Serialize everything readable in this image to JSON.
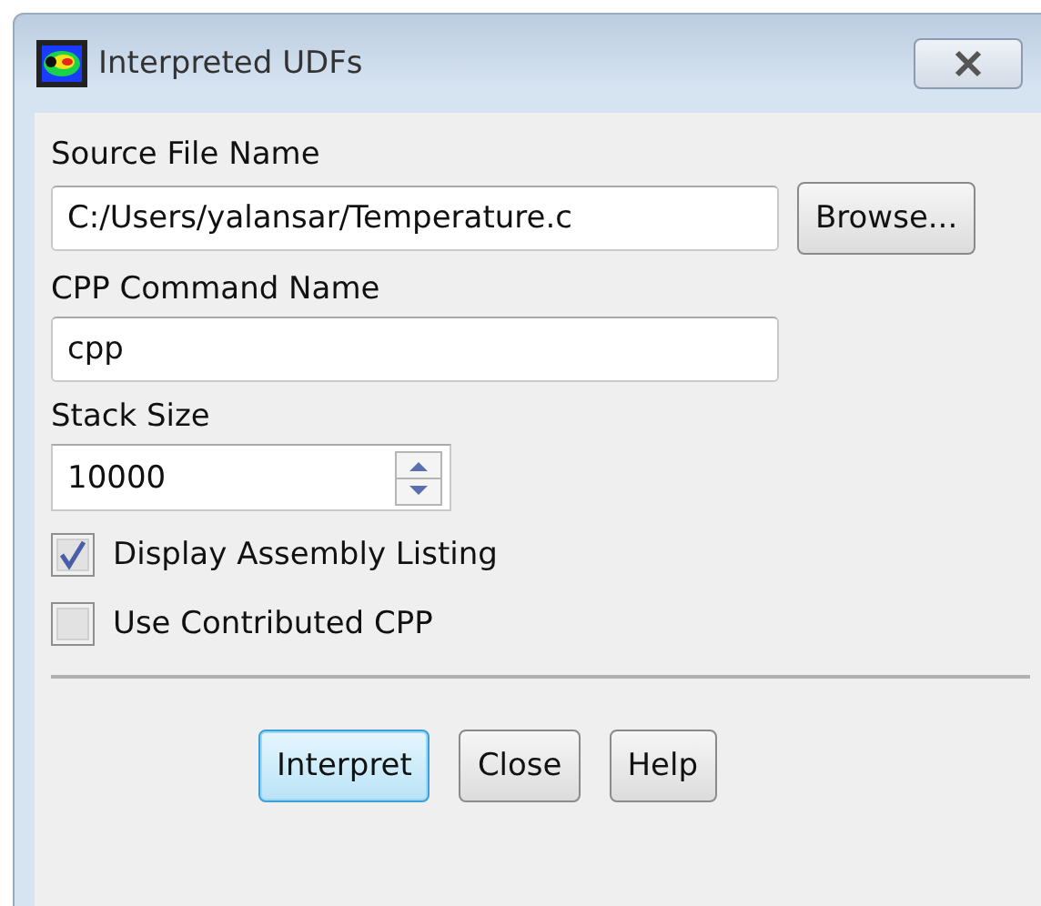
{
  "window": {
    "title": "Interpreted UDFs"
  },
  "source_file": {
    "label": "Source File Name",
    "value": "C:/Users/yalansar/Temperature.c",
    "button": "Browse..."
  },
  "cpp_command": {
    "label": "CPP Command Name",
    "value": "cpp"
  },
  "stack_size": {
    "label": "Stack Size",
    "value": "10000"
  },
  "options": [
    {
      "label": "Display Assembly Listing",
      "checked": true
    },
    {
      "label": "Use Contributed CPP",
      "checked": false
    }
  ],
  "buttons": [
    {
      "label": "Interpret",
      "default": true
    },
    {
      "label": "Close",
      "default": false
    },
    {
      "label": "Help",
      "default": false
    }
  ]
}
